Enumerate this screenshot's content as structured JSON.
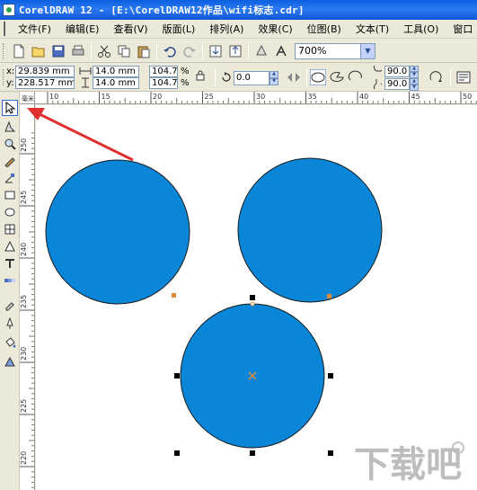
{
  "window": {
    "title": "CorelDRAW 12 - [E:\\CorelDRAW12作品\\wifi标志.cdr]"
  },
  "menu": {
    "items": [
      "文件(F)",
      "编辑(E)",
      "查看(V)",
      "版面(L)",
      "排列(A)",
      "效果(C)",
      "位图(B)",
      "文本(T)",
      "工具(O)",
      "窗口"
    ]
  },
  "toolbar": {
    "zoom_value": "700%"
  },
  "property_bar": {
    "x_label": "x:",
    "x_value": "29.839 mm",
    "y_label": "y:",
    "y_value": "228.517 mm",
    "width_value": "14.0 mm",
    "height_value": "14.0 mm",
    "scale_x": "104.7",
    "scale_y": "104.7",
    "percent": "%",
    "rotation": "0.0",
    "angle_start": "90.0",
    "angle_end": "90.0"
  },
  "rulers": {
    "horizontal_labels": [
      "10",
      "15",
      "20",
      "25",
      "30",
      "35",
      "40",
      "45",
      "50"
    ],
    "vertical_labels": [
      "250",
      "245",
      "240",
      "235",
      "230",
      "225",
      "220"
    ],
    "unit_label": "毫米"
  },
  "canvas": {
    "circle_fill": "#0a86d8",
    "circle_stroke": "#1a1a1a",
    "node_color": "#e08a3c",
    "handle_color": "#000000",
    "arrow_color": "#e03030"
  },
  "watermark": {
    "text": "下载吧"
  }
}
